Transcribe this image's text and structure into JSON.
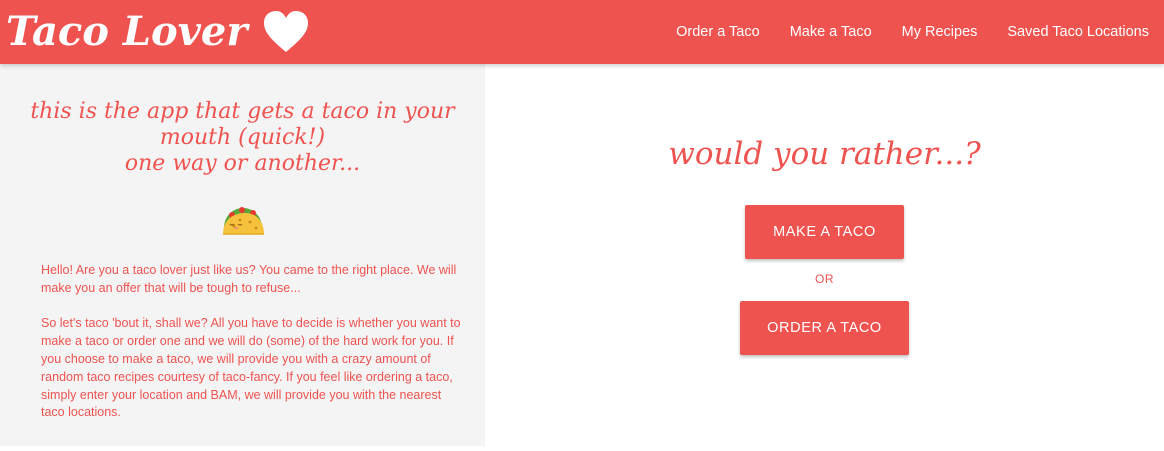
{
  "brand": {
    "title": "Taco Lover",
    "heart_icon": "heart-icon",
    "color": "#ef5350"
  },
  "nav": {
    "items": [
      {
        "label": "Order a Taco"
      },
      {
        "label": "Make a Taco"
      },
      {
        "label": "My Recipes"
      },
      {
        "label": "Saved Taco Locations"
      }
    ]
  },
  "intro": {
    "tagline_line1": "this is the app that gets a taco in your",
    "tagline_line2": "mouth (quick!)",
    "tagline_line3": "one way or another...",
    "emoji_icon": "taco-icon",
    "paragraph1": "Hello! Are you a taco lover just like us? You came to the right place. We will make you an offer that will be tough to refuse...",
    "paragraph2": "So let's taco 'bout it, shall we? All you have to decide is whether you want to make a taco or order one and we will do (some) of the hard work for you. If you choose to make a taco, we will provide you with a crazy amount of random taco recipes courtesy of taco-fancy. If you feel like ordering a taco, simply enter your location and BAM, we will provide you with the nearest taco locations."
  },
  "choice": {
    "question": "would you rather...?",
    "make_label": "MAKE A TACO",
    "or_label": "OR",
    "order_label": "ORDER A TACO"
  },
  "colors": {
    "accent": "#ef5350",
    "panel_bg": "#f4f4f4"
  }
}
